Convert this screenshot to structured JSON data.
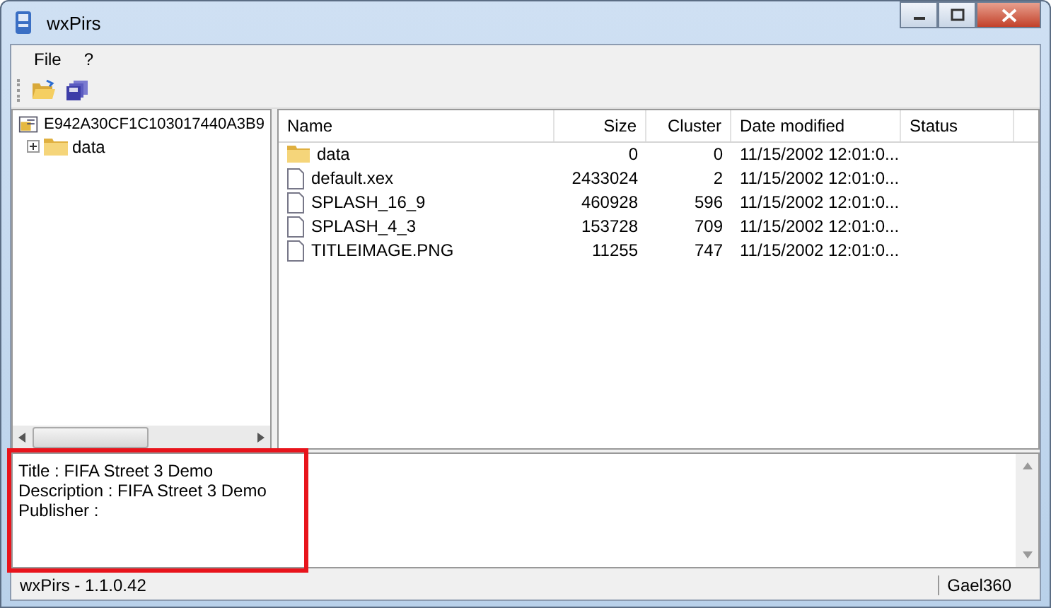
{
  "window": {
    "title": "wxPirs"
  },
  "menu": [
    "File",
    "?"
  ],
  "toolbar": [
    {
      "kind": "open"
    },
    {
      "kind": "extract"
    }
  ],
  "tree": {
    "label": "E942A30CF1C103017440A3B9",
    "children": [
      {
        "label": "data",
        "expanded": false
      }
    ]
  },
  "table": {
    "columns": [
      {
        "label": "Name"
      },
      {
        "label": "Size"
      },
      {
        "label": "Cluster"
      },
      {
        "label": "Date modified"
      },
      {
        "label": "Status"
      }
    ],
    "rows": [
      {
        "kind": "folder",
        "cells": [
          "data",
          "0",
          "0",
          "11/15/2002 12:01:0..."
        ]
      },
      {
        "kind": "file",
        "cells": [
          "default.xex",
          "2433024",
          "2",
          "11/15/2002 12:01:0..."
        ]
      },
      {
        "kind": "file",
        "cells": [
          "SPLASH_16_9",
          "460928",
          "596",
          "11/15/2002 12:01:0..."
        ]
      },
      {
        "kind": "file",
        "cells": [
          "SPLASH_4_3",
          "153728",
          "709",
          "11/15/2002 12:01:0..."
        ]
      },
      {
        "kind": "file",
        "cells": [
          "TITLEIMAGE.PNG",
          "11255",
          "747",
          "11/15/2002 12:01:0..."
        ]
      }
    ]
  },
  "details": [
    "Title : FIFA Street 3 Demo",
    "Description : FIFA Street 3 Demo",
    "Publisher :"
  ],
  "highlight": {
    "color": "#e8141c"
  },
  "status_bar": [
    "wxPirs - 1.1.0.42",
    "Gael360"
  ]
}
